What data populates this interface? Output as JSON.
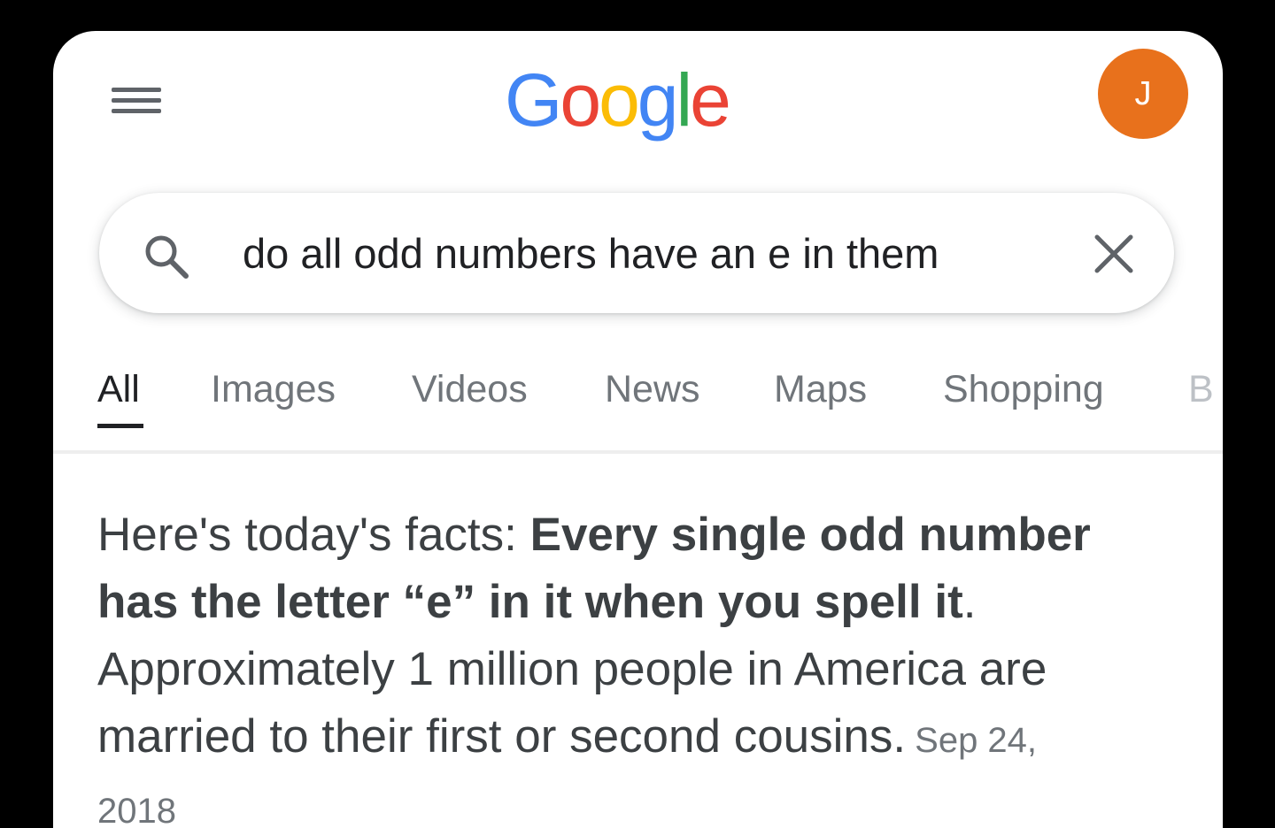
{
  "header": {
    "logo_letters": [
      {
        "char": "G",
        "color": "#4285F4"
      },
      {
        "char": "o",
        "color": "#EA4335"
      },
      {
        "char": "o",
        "color": "#FBBC05"
      },
      {
        "char": "g",
        "color": "#4285F4"
      },
      {
        "char": "l",
        "color": "#34A853"
      },
      {
        "char": "e",
        "color": "#EA4335"
      }
    ],
    "menu_icon": "hamburger-menu-icon",
    "avatar_initial": "J",
    "avatar_color": "#E8711C"
  },
  "search": {
    "query": "do all odd numbers have an e in them",
    "search_icon": "magnifier-icon",
    "clear_icon": "close-icon"
  },
  "tabs": [
    {
      "label": "All",
      "active": true
    },
    {
      "label": "Images",
      "active": false
    },
    {
      "label": "Videos",
      "active": false
    },
    {
      "label": "News",
      "active": false
    },
    {
      "label": "Maps",
      "active": false
    },
    {
      "label": "Shopping",
      "active": false
    },
    {
      "label": "B",
      "active": false
    }
  ],
  "snippet": {
    "lead": "Here's today's facts: ",
    "bold": "Every single odd number has the letter “e” in it when you spell it",
    "period": ". ",
    "rest": "Approximately 1 million people in America are married to their first or second cousins.",
    "date": "Sep 24, 2018"
  },
  "colors": {
    "background": "#000000",
    "page": "#ffffff",
    "text_primary": "#202124",
    "text_secondary": "#70757a"
  }
}
